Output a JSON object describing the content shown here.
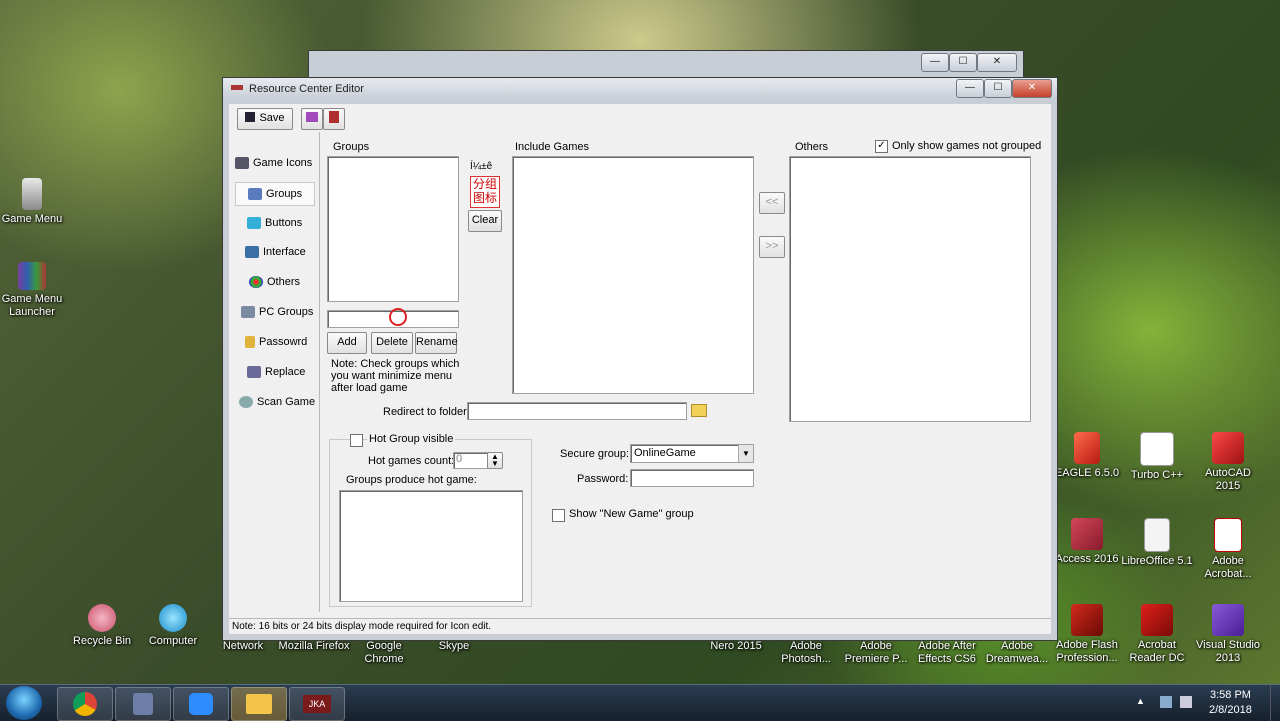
{
  "desktop": {
    "left_icons": [
      {
        "label": "Game Menu"
      },
      {
        "label": "Game Menu Launcher"
      }
    ],
    "bottom_icons": [
      {
        "label": "Recycle Bin"
      },
      {
        "label": "Computer"
      },
      {
        "label": "Network"
      },
      {
        "label": "Mozilla Firefox"
      },
      {
        "label": "Google Chrome"
      },
      {
        "label": "Skype"
      },
      {
        "label": "Nero 2015"
      },
      {
        "label": "Adobe Photosh..."
      },
      {
        "label": "Adobe Premiere P..."
      },
      {
        "label": "Adobe After Effects CS6"
      },
      {
        "label": "Adobe Dreamwea..."
      }
    ],
    "right_icons": [
      {
        "label": "EAGLE 6.5.0"
      },
      {
        "label": "Turbo C++"
      },
      {
        "label": "AutoCAD 2015"
      },
      {
        "label": "Access 2016"
      },
      {
        "label": "LibreOffice 5.1"
      },
      {
        "label": "Adobe Acrobat..."
      },
      {
        "label": "Adobe Flash Profession..."
      },
      {
        "label": "Acrobat Reader DC"
      },
      {
        "label": "Visual Studio 2013"
      }
    ]
  },
  "taskbar": {
    "time": "3:58 PM",
    "date": "2/8/2018",
    "pinned": [
      "chrome",
      "app",
      "zoom",
      "file-explorer",
      "jka"
    ],
    "tray_arrow": "▲"
  },
  "window": {
    "title": "Resource Center Editor",
    "toolbar": {
      "save_label": "Save"
    },
    "nav": [
      "Game Icons",
      "Groups",
      "Buttons",
      "Interface",
      "Others",
      "PC Groups",
      "Passowrd",
      "Replace",
      "Scan Game"
    ],
    "nav_selected": "Groups",
    "groups_label": "Groups",
    "icon_label": "Í¼±ê",
    "icon_glyph_line1": "分组",
    "icon_glyph_line2": "图标",
    "clear_label": "Clear",
    "include_games_label": "Include Games",
    "others_label": "Others",
    "only_show_label": "Only show games not grouped",
    "only_show_checked": true,
    "move_left_label": "<<",
    "move_right_label": ">>",
    "add_label": "Add",
    "delete_label": "Delete",
    "rename_label": "Rename",
    "note_text": "Note: Check groups which you want minimize menu after load game",
    "redirect_label": "Redirect to folder:",
    "redirect_value": "",
    "hot_group_label": "Hot Group visible",
    "hot_count_label": "Hot games count:",
    "hot_count_value": "0",
    "groups_produce_label": "Groups produce hot game:",
    "secure_group_label": "Secure group:",
    "secure_group_value": "OnlineGame",
    "password_label": "Password:",
    "password_value": "",
    "show_new_game_label": "Show \"New Game\" group",
    "status_text": "Note: 16 bits or 24 bits display mode required for Icon edit.",
    "min_label": "—",
    "max_label": "☐",
    "close_label": "✕"
  }
}
